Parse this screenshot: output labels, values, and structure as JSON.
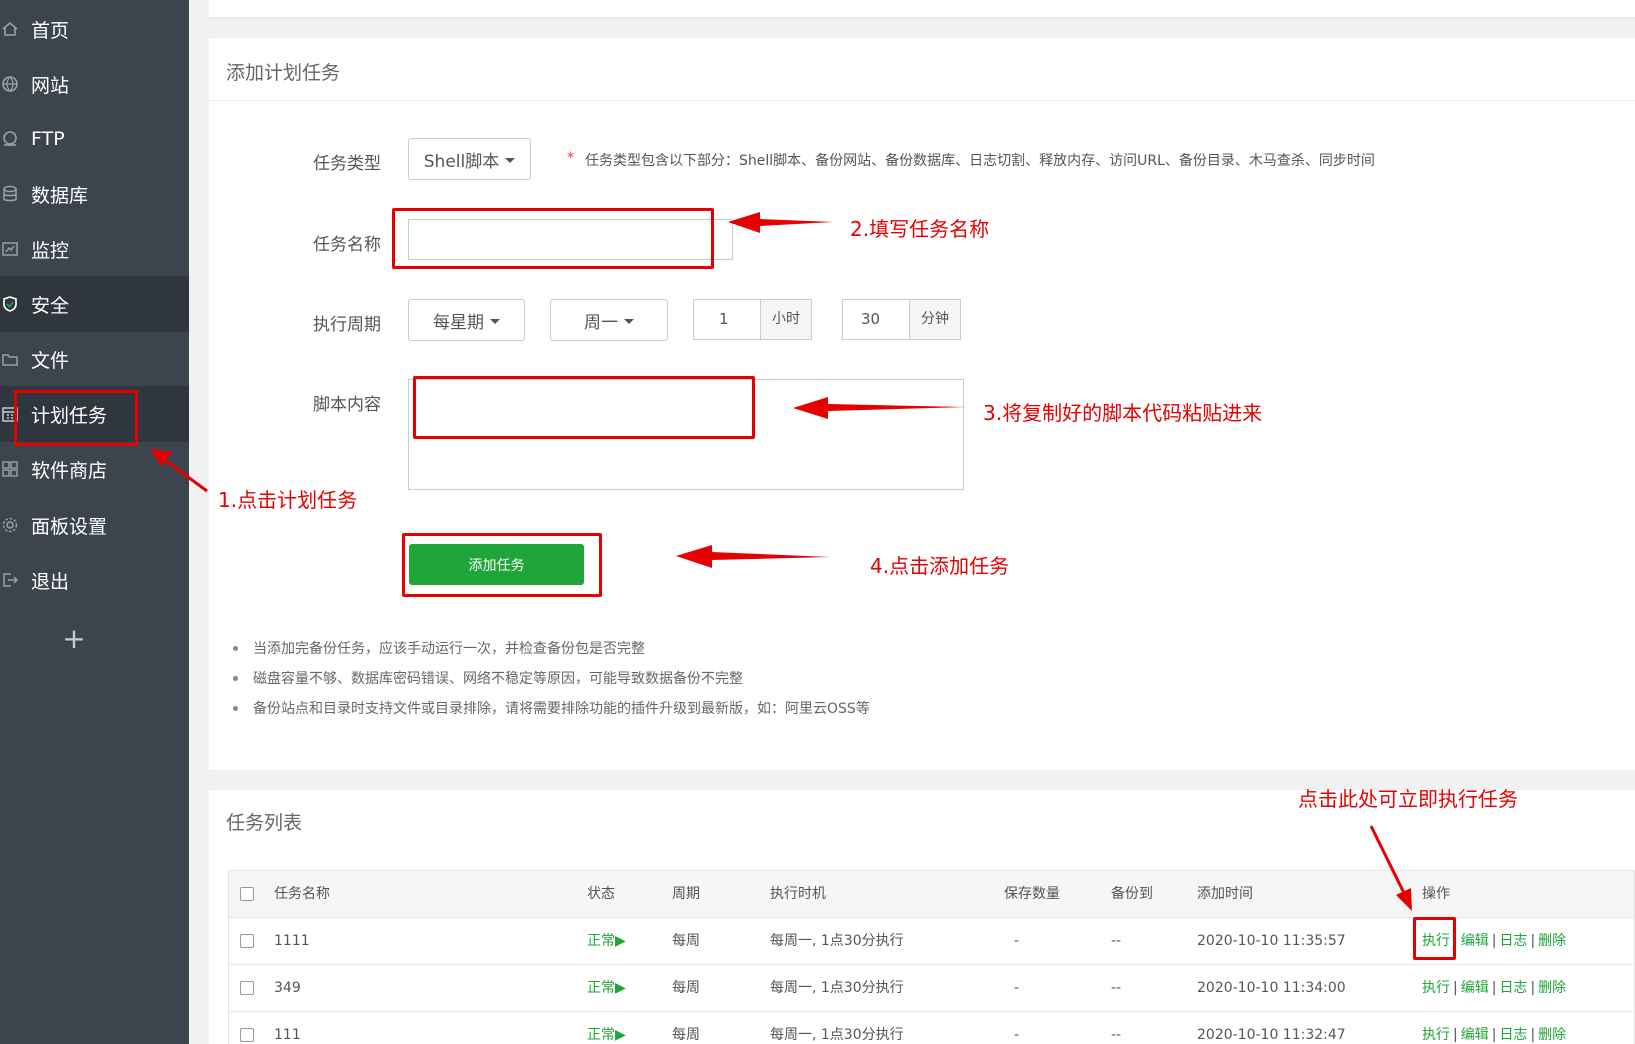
{
  "sidebar": {
    "items": [
      {
        "label": "首页",
        "icon": "home-icon"
      },
      {
        "label": "网站",
        "icon": "globe-icon"
      },
      {
        "label": "FTP",
        "icon": "ftp-icon"
      },
      {
        "label": "数据库",
        "icon": "database-icon"
      },
      {
        "label": "监控",
        "icon": "monitor-icon"
      },
      {
        "label": "安全",
        "icon": "shield-icon"
      },
      {
        "label": "文件",
        "icon": "folder-icon"
      },
      {
        "label": "计划任务",
        "icon": "calendar-icon"
      },
      {
        "label": "软件商店",
        "icon": "grid-icon"
      },
      {
        "label": "面板设置",
        "icon": "gear-icon"
      },
      {
        "label": "退出",
        "icon": "logout-icon"
      }
    ],
    "add_label": "+"
  },
  "form": {
    "title": "添加计划任务",
    "type_label": "任务类型",
    "type_value": "Shell脚本",
    "type_note_star": "*",
    "type_note": "任务类型包含以下部分：Shell脚本、备份网站、备份数据库、日志切割、释放内存、访问URL、备份目录、木马查杀、同步时间",
    "name_label": "任务名称",
    "name_value": "",
    "period_label": "执行周期",
    "period_value": "每星期",
    "weekday_value": "周一",
    "hour_value": "1",
    "hour_unit": "小时",
    "minute_value": "30",
    "minute_unit": "分钟",
    "script_label": "脚本内容",
    "script_value": "",
    "submit_label": "添加任务",
    "tips": [
      "当添加完备份任务，应该手动运行一次，并检查备份包是否完整",
      "磁盘容量不够、数据库密码错误、网络不稳定等原因，可能导致数据备份不完整",
      "备份站点和目录时支持文件或目录排除，请将需要排除功能的插件升级到最新版，如：阿里云OSS等"
    ]
  },
  "task_list": {
    "title": "任务列表",
    "columns": [
      "任务名称",
      "状态",
      "周期",
      "执行时机",
      "保存数量",
      "备份到",
      "添加时间",
      "操作"
    ],
    "rows": [
      {
        "name": "1111",
        "status": "正常▶",
        "cycle": "每周",
        "timing": "每周一, 1点30分执行",
        "keep": "-",
        "backup_to": "--",
        "added": "2020-10-10 11:35:57"
      },
      {
        "name": "349",
        "status": "正常▶",
        "cycle": "每周",
        "timing": "每周一, 1点30分执行",
        "keep": "-",
        "backup_to": "--",
        "added": "2020-10-10 11:34:00"
      },
      {
        "name": "111",
        "status": "正常▶",
        "cycle": "每周",
        "timing": "每周一, 1点30分执行",
        "keep": "-",
        "backup_to": "--",
        "added": "2020-10-10 11:32:47"
      }
    ],
    "actions": {
      "run": "执行",
      "edit": "编辑",
      "log": "日志",
      "delete": "删除",
      "sep": "|"
    }
  },
  "annotations": {
    "step1": "1.点击计划任务",
    "step2": "2.填写任务名称",
    "step3": "3.将复制好的脚本代码粘贴进来",
    "step4": "4.点击添加任务",
    "run_hint": "点击此处可立即执行任务",
    "color": "#e60000"
  },
  "colors": {
    "sidebar_bg": "#3c444d",
    "accent_green": "#20a53a"
  }
}
